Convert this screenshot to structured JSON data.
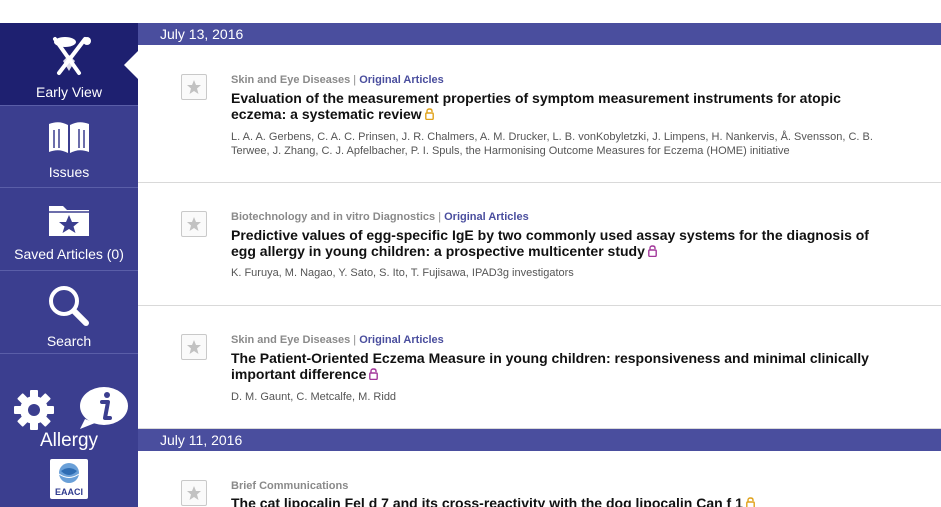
{
  "sidebar": {
    "items": [
      {
        "label": "Early View",
        "icon": "early-view-icon"
      },
      {
        "label": "Issues",
        "icon": "book-icon"
      },
      {
        "label": "Saved Articles (0)",
        "icon": "saved-folder-star-icon"
      },
      {
        "label": "Search",
        "icon": "search-icon"
      }
    ],
    "brand": "Allergy",
    "society_logo": "EAACI"
  },
  "content": {
    "sections": [
      {
        "date": "July 13, 2016",
        "articles": [
          {
            "category": "Skin and Eye Diseases",
            "type": "Original Articles",
            "title": "Evaluation of the measurement properties of symptom measurement instruments for atopic eczema: a systematic review",
            "authors": "L. A. A. Gerbens, C. A. C. Prinsen, J. R. Chalmers, A. M. Drucker, L. B. vonKobyletzki, J. Limpens, H. Nankervis, Å. Svensson, C. B. Terwee, J. Zhang, C. J. Apfelbacher, P. I. Spuls, the Harmonising Outcome Measures for Eczema (HOME) initiative",
            "lock_color": "#e0a21a"
          },
          {
            "category": "Biotechnology and in vitro Diagnostics",
            "type": "Original Articles",
            "title": "Predictive values of egg-specific IgE by two commonly used assay systems for the diagnosis of egg allergy in young children: a prospective multicenter study",
            "authors": "K. Furuya, M. Nagao, Y. Sato, S. Ito, T. Fujisawa, IPAD3g investigators",
            "lock_color": "#a2379a"
          },
          {
            "category": "Skin and Eye Diseases",
            "type": "Original Articles",
            "title": "The Patient-Oriented Eczema Measure in young children: responsiveness and minimal clinically important difference",
            "authors": "D. M. Gaunt, C. Metcalfe, M. Ridd",
            "lock_color": "#a2379a"
          }
        ]
      },
      {
        "date": "July 11, 2016",
        "articles": [
          {
            "category": "Brief Communications",
            "type": "",
            "title": "The cat lipocalin Fel d 7 and its cross-reactivity with the dog lipocalin Can f 1",
            "authors": "",
            "lock_color": "#e0a21a"
          }
        ]
      }
    ]
  },
  "colors": {
    "sidebar_bg": "#3b3e8f",
    "sidebar_active": "#1e2070",
    "date_bar": "#4a4e9e",
    "category_text": "#8a8a8a",
    "type_text": "#4a4e9e"
  }
}
